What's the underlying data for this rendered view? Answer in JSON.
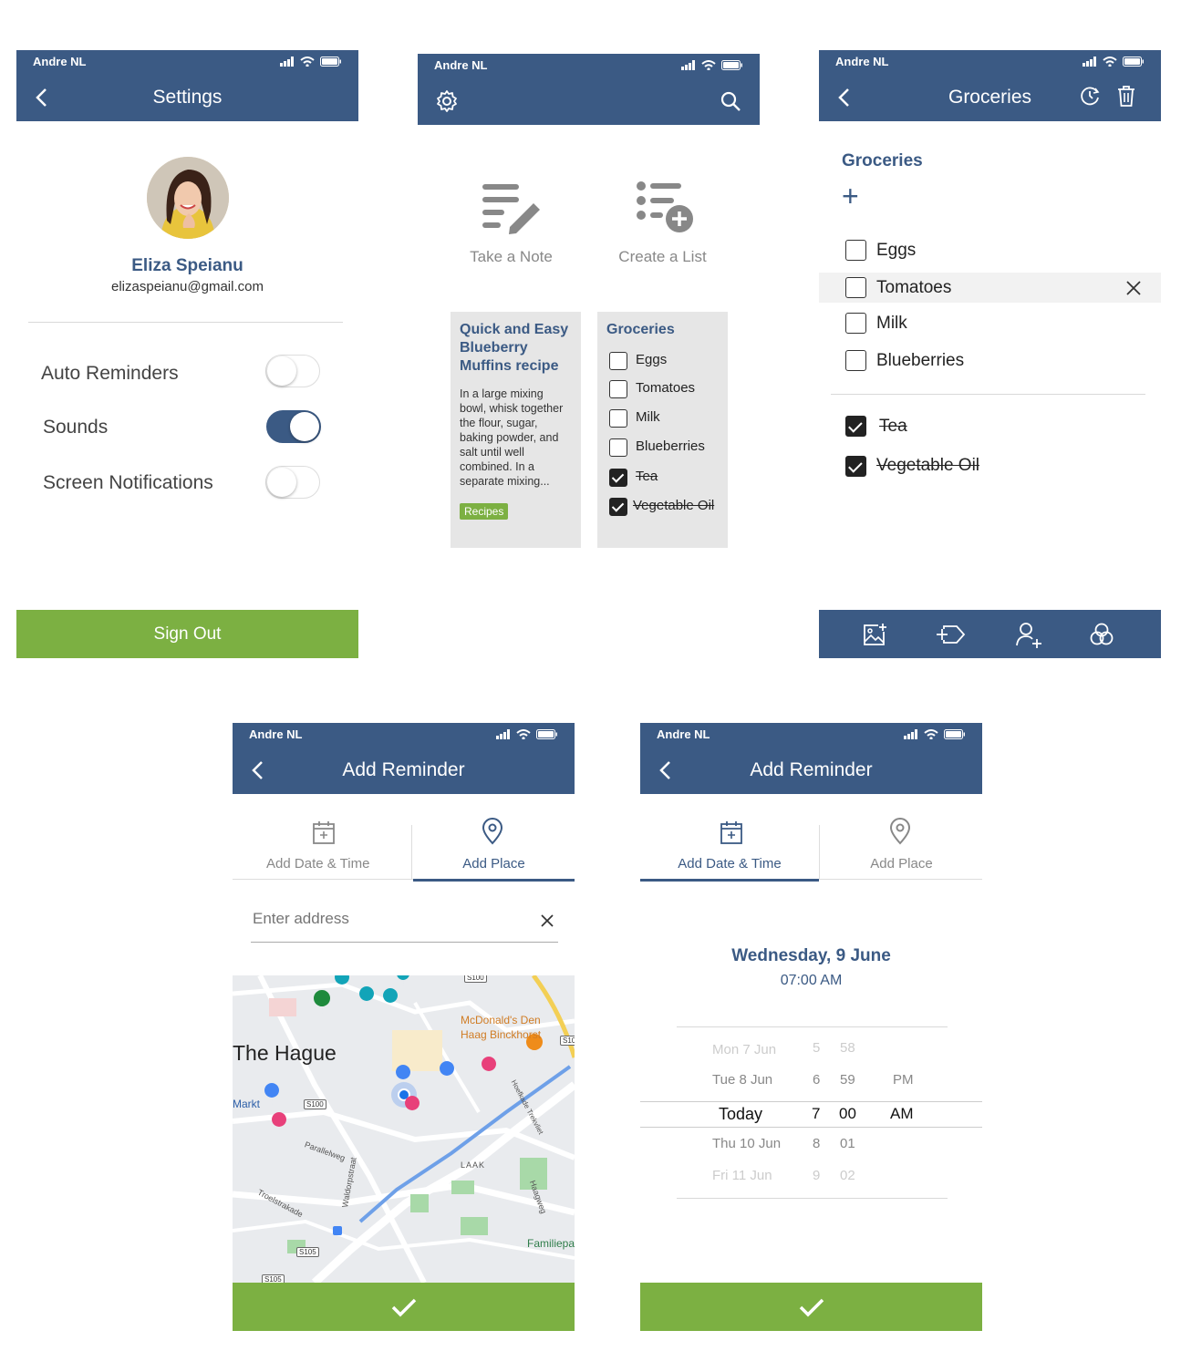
{
  "carrier": "Andre NL",
  "colors": {
    "primary": "#3b5a84",
    "accent": "#7cb042",
    "card": "#e6e6e6"
  },
  "settings": {
    "title": "Settings",
    "name": "Eliza Speianu",
    "email": "elizaspeianu@gmail.com",
    "options": [
      {
        "label": "Auto Reminders",
        "on": false
      },
      {
        "label": "Sounds",
        "on": true
      },
      {
        "label": "Screen Notifications",
        "on": false
      }
    ],
    "sign_out": "Sign Out"
  },
  "home": {
    "take_note": "Take a Note",
    "create_list": "Create a List",
    "note_card": {
      "title": "Quick and Easy Blueberry Muffins recipe",
      "body": "In a large mixing bowl, whisk together the flour, sugar, baking powder, and salt until well combined. In a separate mixing...",
      "tag": "Recipes"
    },
    "list_card": {
      "title": "Groceries",
      "items": [
        {
          "label": "Eggs",
          "checked": false
        },
        {
          "label": "Tomatoes",
          "checked": false
        },
        {
          "label": "Milk",
          "checked": false
        },
        {
          "label": "Blueberries",
          "checked": false
        },
        {
          "label": "Tea",
          "checked": true
        },
        {
          "label": "Vegetable Oil",
          "checked": true
        }
      ]
    }
  },
  "groceries": {
    "title": "Groceries",
    "heading": "Groceries",
    "add": "+",
    "items": [
      {
        "label": "Eggs",
        "checked": false
      },
      {
        "label": "Tomatoes",
        "checked": false
      },
      {
        "label": "Milk",
        "checked": false
      },
      {
        "label": "Blueberries",
        "checked": false
      },
      {
        "label": "Tea",
        "checked": true
      },
      {
        "label": "Vegetable Oil",
        "checked": true
      }
    ]
  },
  "reminder": {
    "title": "Add Reminder",
    "tab_date": "Add Date & Time",
    "tab_place": "Add Place",
    "address_placeholder": "Enter address",
    "map_labels": {
      "city": "The Hague",
      "mcd1": "McDonald's Den",
      "mcd2": "Haag Binckhorst",
      "markt": "Markt",
      "laak": "LAAK",
      "parallelweg": "Parallelweg",
      "troelstrakade": "Troelstrakade",
      "waldorpstraat": "Waldorpstraat",
      "haagweg": "Haagweg",
      "familiepark": "Familiepa",
      "s100a": "S100",
      "s100b": "S100",
      "s105a": "S105",
      "s105b": "S105",
      "s10": "S10",
      "schenk": "Hoefkade Trekvliet"
    },
    "selected_date": "Wednesday, 9 June",
    "selected_time": "07:00 AM",
    "wheel": [
      {
        "day": "Mon 7 Jun",
        "h": "5",
        "m": "58",
        "ap": ""
      },
      {
        "day": "Tue 8 Jun",
        "h": "6",
        "m": "59",
        "ap": "PM"
      },
      {
        "day": "Today",
        "h": "7",
        "m": "00",
        "ap": "AM"
      },
      {
        "day": "Thu 10 Jun",
        "h": "8",
        "m": "01",
        "ap": ""
      },
      {
        "day": "Fri 11 Jun",
        "h": "9",
        "m": "02",
        "ap": ""
      }
    ]
  }
}
